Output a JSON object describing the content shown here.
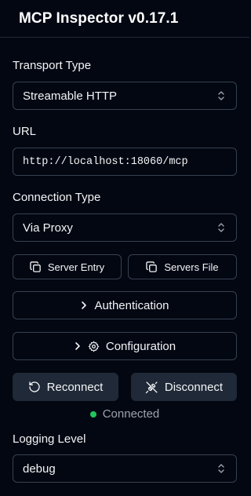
{
  "header": {
    "title": "MCP Inspector v0.17.1"
  },
  "transport": {
    "label": "Transport Type",
    "value": "Streamable HTTP",
    "icon": "chevron-up-down-icon"
  },
  "url": {
    "label": "URL",
    "value": "http://localhost:18060/mcp"
  },
  "connection": {
    "label": "Connection Type",
    "value": "Via Proxy"
  },
  "config_buttons": {
    "server_entry": {
      "label": "Server Entry",
      "icon": "copy-icon"
    },
    "servers_file": {
      "label": "Servers File",
      "icon": "copy-icon"
    }
  },
  "sections": {
    "authentication": {
      "label": "Authentication",
      "icon": "chevron-right-icon"
    },
    "configuration": {
      "label": "Configuration",
      "icon": "gear-icon"
    }
  },
  "actions": {
    "reconnect": {
      "label": "Reconnect",
      "icon": "rotate-ccw-icon"
    },
    "disconnect": {
      "label": "Disconnect",
      "icon": "unplug-icon"
    }
  },
  "status": {
    "text": "Connected",
    "color": "#22c55e"
  },
  "logging": {
    "label": "Logging Level",
    "value": "debug"
  },
  "colors": {
    "background": "#030712",
    "border": "#374151",
    "button_dark": "#1f2937",
    "text": "#f3f4f6",
    "muted": "#9ca3af"
  }
}
